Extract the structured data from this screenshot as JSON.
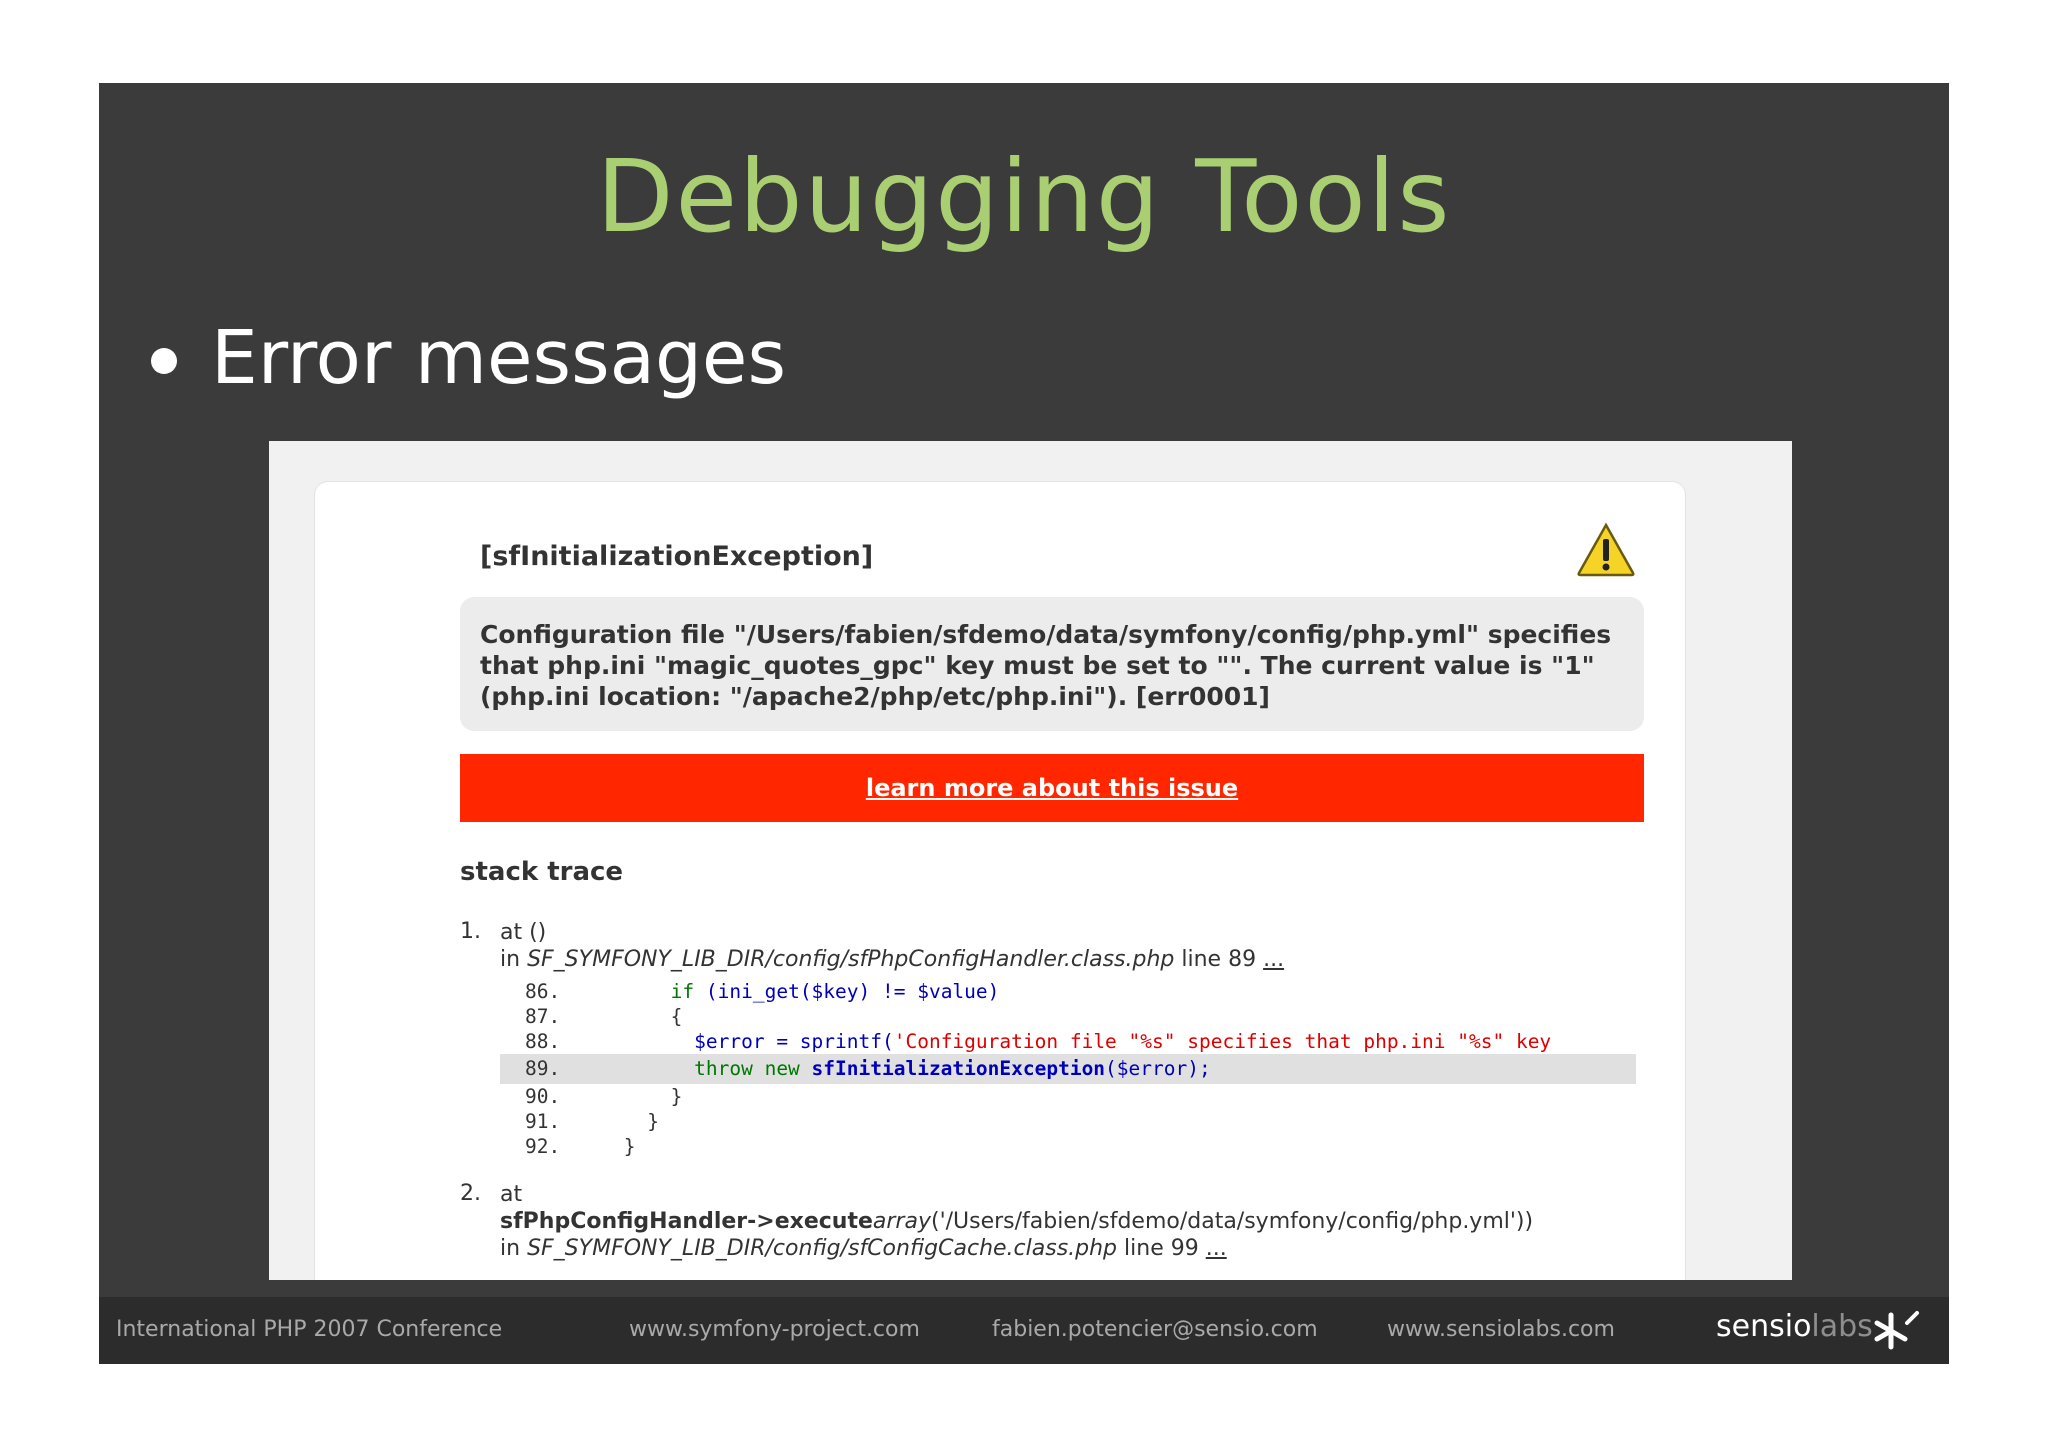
{
  "slide": {
    "title": "Debugging Tools",
    "bullet": "Error messages"
  },
  "error_page": {
    "exception": "[sfInitializationException]",
    "message": "Configuration file \"/Users/fabien/sfdemo/data/symfony/config/php.yml\" specifies that php.ini \"magic_quotes_gpc\" key must be set to \"\". The current value is \"1\" (php.ini location: \"/apache2/php/etc/php.ini\"). [err0001]",
    "learn_more": "learn more about this issue",
    "stack_title": "stack trace",
    "trace": {
      "e1_num": "1.",
      "e1_at": "at ()",
      "e1_in": "in",
      "e1_file": "SF_SYMFONY_LIB_DIR/config/sfPhpConfigHandler.class.php",
      "e1_line": "line 89",
      "dots": "...",
      "code": {
        "l86": "86.",
        "c86_kw": "if",
        "c86_rest": " (ini_get($key) != $value)",
        "l87": "87.",
        "c87": "{",
        "l88": "88.",
        "c88_var": "$error = sprintf(",
        "c88_str": "'Configuration file \"%s\" specifies that php.ini \"%s\" key",
        "l89": "89.",
        "c89_kw": "throw new ",
        "c89_fn": "sfInitializationException",
        "c89_rest": "($error);",
        "l90": "90.",
        "c90": "}",
        "l91": "91.",
        "c91": "}",
        "l92": "92.",
        "c92": "}"
      },
      "e2_num": "2.",
      "e2_at": "at",
      "e2_call": "sfPhpConfigHandler->execute",
      "e2_args_kw": "array",
      "e2_args": "('/Users/fabien/sfdemo/data/symfony/config/php.yml'))",
      "e2_in": "in",
      "e2_file": "SF_SYMFONY_LIB_DIR/config/sfConfigCache.class.php",
      "e2_line": "line 99"
    }
  },
  "footer": {
    "conference": "International PHP 2007 Conference",
    "site": "www.symfony-project.com",
    "email": "fabien.potencier@sensio.com",
    "company_site": "www.sensiolabs.com",
    "brand_a": "sensio",
    "brand_b": "labs"
  },
  "colors": {
    "slide_bg": "#3b3b3b",
    "title": "#a9cf72",
    "learn_bar": "#ff2600",
    "footer_bg": "#2c2c2c"
  },
  "icons": [
    "warning-icon",
    "sensiolabs-logo-icon"
  ]
}
